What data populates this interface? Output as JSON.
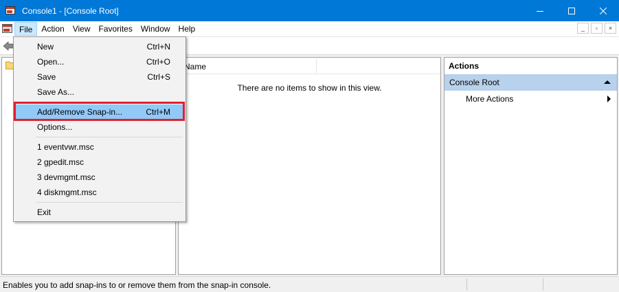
{
  "window": {
    "title": "Console1 - [Console Root]"
  },
  "menubar": {
    "items": [
      "File",
      "Action",
      "View",
      "Favorites",
      "Window",
      "Help"
    ],
    "mdi_minimize": "_",
    "mdi_restore": "▫",
    "mdi_close": "×"
  },
  "file_menu": {
    "new": {
      "label": "New",
      "shortcut": "Ctrl+N"
    },
    "open": {
      "label": "Open...",
      "shortcut": "Ctrl+O"
    },
    "save": {
      "label": "Save",
      "shortcut": "Ctrl+S"
    },
    "save_as": {
      "label": "Save As..."
    },
    "add_remove": {
      "label": "Add/Remove Snap-in...",
      "shortcut": "Ctrl+M"
    },
    "options": {
      "label": "Options..."
    },
    "recent": [
      "1 eventvwr.msc",
      "2 gpedit.msc",
      "3 devmgmt.msc",
      "4 diskmgmt.msc"
    ],
    "exit": {
      "label": "Exit"
    }
  },
  "list": {
    "column_name": "Name",
    "empty_message": "There are no items to show in this view."
  },
  "actions": {
    "title": "Actions",
    "group": "Console Root",
    "more_actions": "More Actions"
  },
  "status": {
    "text": "Enables you to add snap-ins to or remove them from the snap-in console."
  },
  "colors": {
    "titlebar": "#0078d7",
    "menu_highlight": "#91c9f7",
    "annotation_box": "#e0202e",
    "actions_group": "#b8d1ec"
  }
}
